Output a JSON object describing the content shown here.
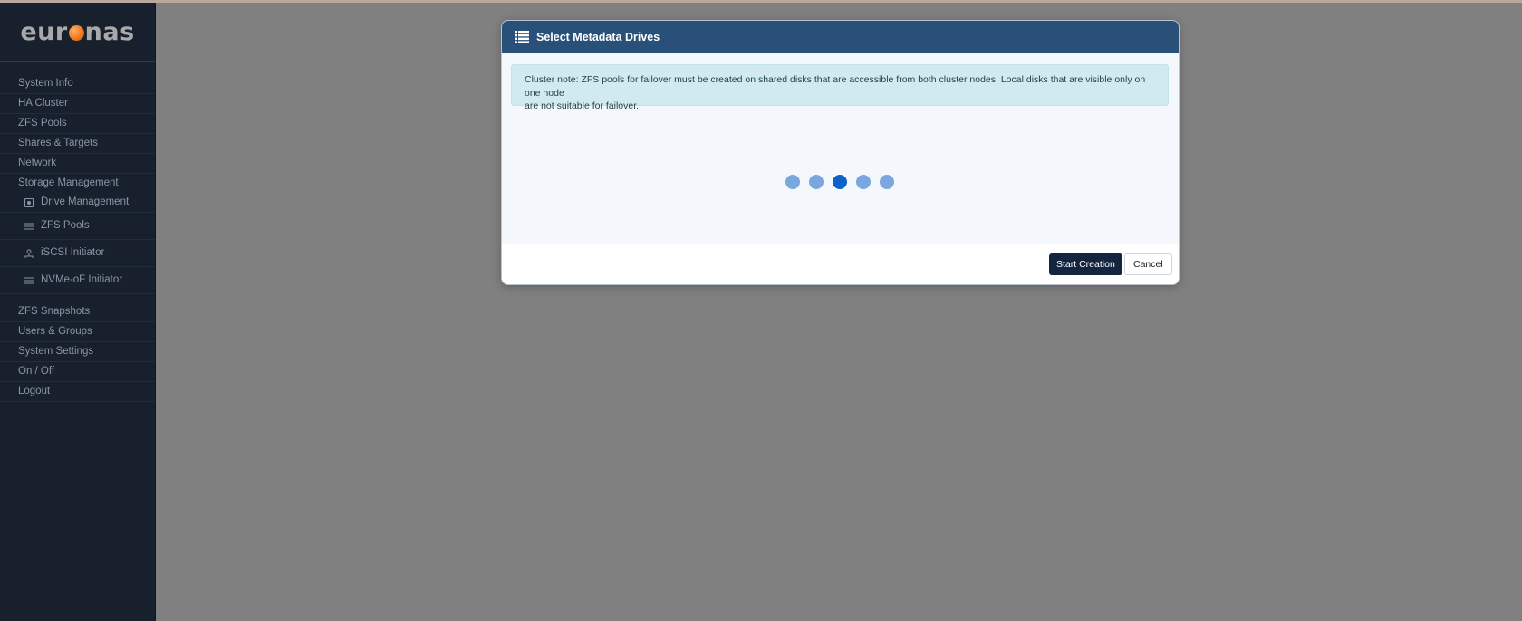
{
  "app": {
    "logo_prefix": "eur",
    "logo_suffix": "nas"
  },
  "sidebar": {
    "items": [
      {
        "label": "System Info"
      },
      {
        "label": "HA Cluster"
      },
      {
        "label": "ZFS Pools"
      },
      {
        "label": "Shares & Targets"
      },
      {
        "label": "Network"
      },
      {
        "label": "Storage Management"
      }
    ],
    "sub_items": [
      {
        "label": "Drive Management",
        "icon": "drive-icon"
      },
      {
        "label": "ZFS Pools",
        "icon": "layers-icon"
      },
      {
        "label": "iSCSI Initiator",
        "icon": "network-node-icon"
      },
      {
        "label": "NVMe-oF Initiator",
        "icon": "layers-icon"
      }
    ],
    "items_after": [
      {
        "label": "ZFS Snapshots"
      },
      {
        "label": "Users & Groups"
      },
      {
        "label": "System Settings"
      },
      {
        "label": "On / Off"
      },
      {
        "label": "Logout"
      }
    ]
  },
  "modal": {
    "title": "Select Metadata Drives",
    "title_icon": "list-icon",
    "note_line1": "Cluster note: ZFS pools for failover must be created on shared disks that are accessible from both cluster nodes. Local disks that are visible only on one node",
    "note_line2": "are not suitable for failover.",
    "loader_active_index": 2,
    "buttons": {
      "start": "Start Creation",
      "cancel": "Cancel"
    }
  },
  "colors": {
    "sidebar_bg": "#17202c",
    "header_bg": "#285078",
    "alert_bg": "#d1eaef",
    "primary_button": "#14263f",
    "loader_dot": "#7aa7de",
    "loader_dot_active": "#0b63c7",
    "logo_accent": "#f0791f"
  }
}
